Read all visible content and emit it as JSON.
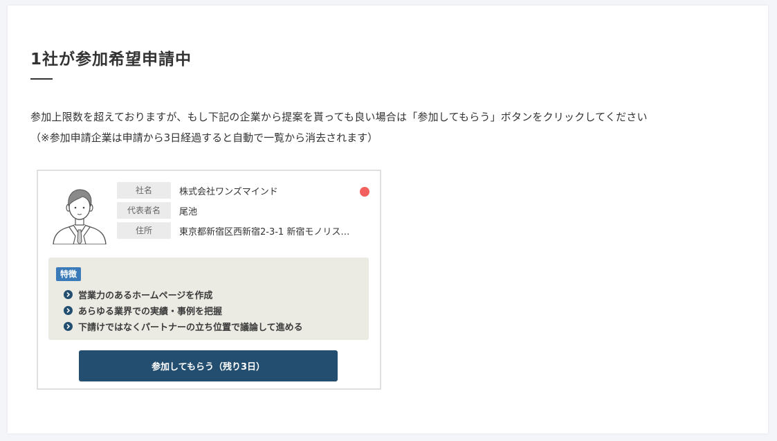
{
  "page": {
    "title": "1社が参加希望申請中",
    "description_line1": "参加上限数を超えておりますが、もし下記の企業から提案を貰っても良い場合は「参加してもらう」ボタンをクリックしてください",
    "description_line2": "（※参加申請企業は申請から3日経過すると自動で一覧から消去されます）"
  },
  "applicant": {
    "company_label": "社名",
    "company_value": "株式会社ワンズマインド",
    "representative_label": "代表者名",
    "representative_value": "尾池",
    "address_label": "住所",
    "address_value": "東京都新宿区西新宿2-3-1 新宿モノリス…",
    "status_color": "#f2605d",
    "avatar_icon": "businessman-avatar-icon",
    "features": {
      "badge_label": "特徴",
      "items": [
        "営業力のあるホームページを作成",
        "あらゆる業界での実績・事例を把握",
        "下請けではなくパートナーの立ち位置で議論して進める"
      ]
    },
    "join_button_label": "参加してもらう（残り3日）"
  },
  "colors": {
    "accent": "#234e70",
    "badge": "#3a7ab8",
    "status_dot": "#f2605d",
    "features_bg": "#ebeae3"
  }
}
